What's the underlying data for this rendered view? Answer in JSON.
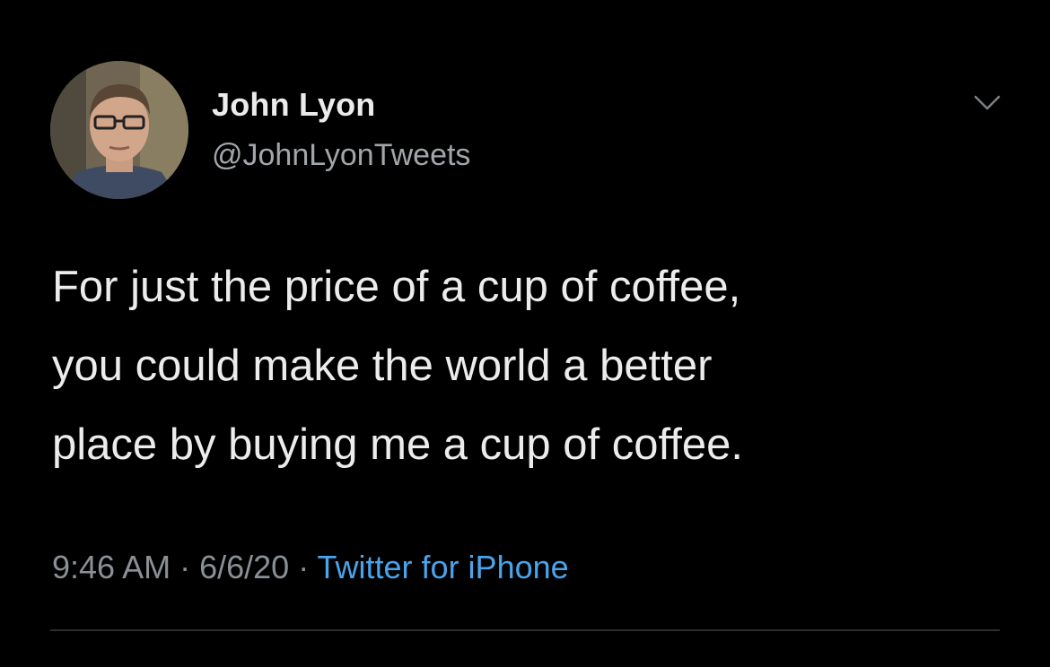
{
  "tweet": {
    "author": {
      "name": "John Lyon",
      "handle": "@JohnLyonTweets"
    },
    "text_lines": [
      "For just the price of a cup of coffee,",
      "you could make the world a better",
      "place by buying me a cup of coffee."
    ],
    "meta": {
      "time": "9:46 AM",
      "separator": " · ",
      "date": "6/6/20",
      "source": "Twitter for iPhone"
    },
    "icons": {
      "menu": "chevron-down-icon",
      "avatar": "profile-photo"
    },
    "colors": {
      "background": "#000000",
      "text": "#ececec",
      "secondary": "#8b9096",
      "link": "#4aa4eb"
    }
  }
}
